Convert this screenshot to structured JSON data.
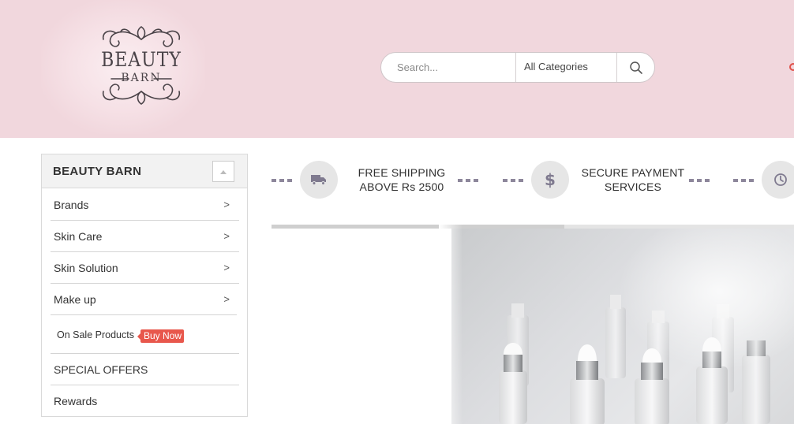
{
  "header": {
    "logo": {
      "line1": "BEAUTY",
      "line2": "BARN"
    },
    "search": {
      "placeholder": "Search...",
      "category": "All Categories"
    }
  },
  "sidebar": {
    "title": "BEAUTY BARN",
    "items": [
      {
        "label": "Brands",
        "has_submenu": true
      },
      {
        "label": "Skin Care",
        "has_submenu": true
      },
      {
        "label": "Skin Solution",
        "has_submenu": true
      },
      {
        "label": "Make up",
        "has_submenu": true
      }
    ],
    "on_sale": {
      "label": "On Sale Products",
      "badge": "Buy Now"
    },
    "extras": [
      {
        "label": "SPECIAL OFFERS"
      },
      {
        "label": "Rewards"
      }
    ]
  },
  "features": [
    {
      "icon": "truck-icon",
      "line1": "FREE SHIPPING",
      "line2": "ABOVE Rs 2500"
    },
    {
      "icon": "dollar-icon",
      "line1": "SECURE PAYMENT",
      "line2": "SERVICES"
    },
    {
      "icon": "clock-icon",
      "line1": "",
      "line2": ""
    }
  ],
  "banner": {
    "slider_progress": 0.56,
    "image": "serum-bottles"
  },
  "colors": {
    "header_bg": "#f1d7dd",
    "badge": "#e8574c",
    "dash": "#8d879b",
    "text": "#333333"
  }
}
